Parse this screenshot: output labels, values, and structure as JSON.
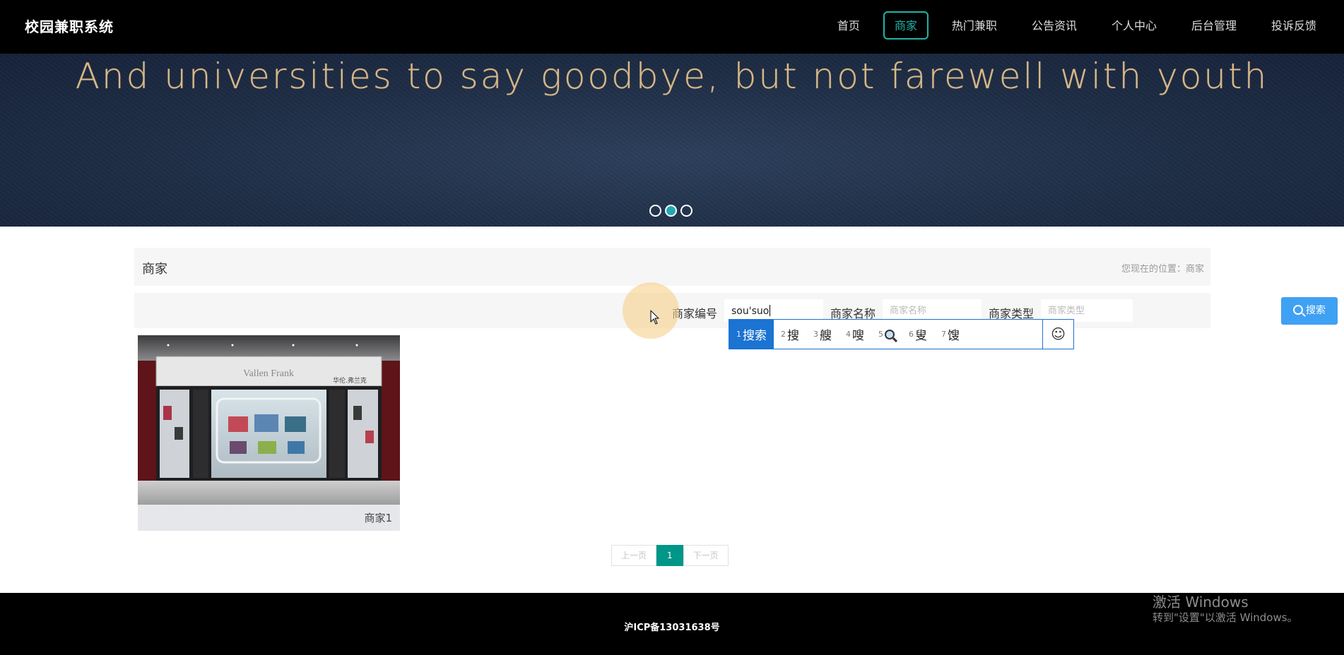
{
  "header": {
    "brand": "校园兼职系统",
    "nav": [
      "首页",
      "商家",
      "热门兼职",
      "公告资讯",
      "个人中心",
      "后台管理",
      "投诉反馈"
    ],
    "active_nav": "商家"
  },
  "banner": {
    "text": "And universities to say goodbye, but not farewell with youth",
    "slide_count": 3,
    "active_slide": 2
  },
  "section": {
    "title": "商家",
    "breadcrumb": "您现在的位置：商家"
  },
  "search": {
    "label_id": "商家编号",
    "id_value": "sou'suo",
    "label_name": "商家名称",
    "placeholder_name": "商家名称",
    "label_type": "商家类型",
    "placeholder_type": "商家类型",
    "button_label": "搜索"
  },
  "ime": {
    "candidates": [
      {
        "num": "1",
        "text": "搜索"
      },
      {
        "num": "2",
        "text": "搜"
      },
      {
        "num": "3",
        "text": "艘"
      },
      {
        "num": "4",
        "text": "嗖"
      },
      {
        "num": "5",
        "icon": "magnifier-emoji-icon"
      },
      {
        "num": "6",
        "text": "叟"
      },
      {
        "num": "7",
        "text": "馊"
      }
    ],
    "selected_index": 0,
    "emoji": "☺"
  },
  "merchants": [
    {
      "name": "商家1",
      "store_sign": "华伦.弗兰克",
      "store_logo": "Vallen Frank"
    }
  ],
  "pager": {
    "prev": "上一页",
    "current": "1",
    "next": "下一页"
  },
  "footer": {
    "icp": "沪ICP备13031638号"
  },
  "watermark": {
    "line1": "激活 Windows",
    "line2": "转到\"设置\"以激活 Windows。"
  },
  "colors": {
    "accent_teal": "#23b2a6",
    "search_button": "#3fa1f3",
    "pager_active": "#009688",
    "ime_blue": "#1b73d2"
  }
}
